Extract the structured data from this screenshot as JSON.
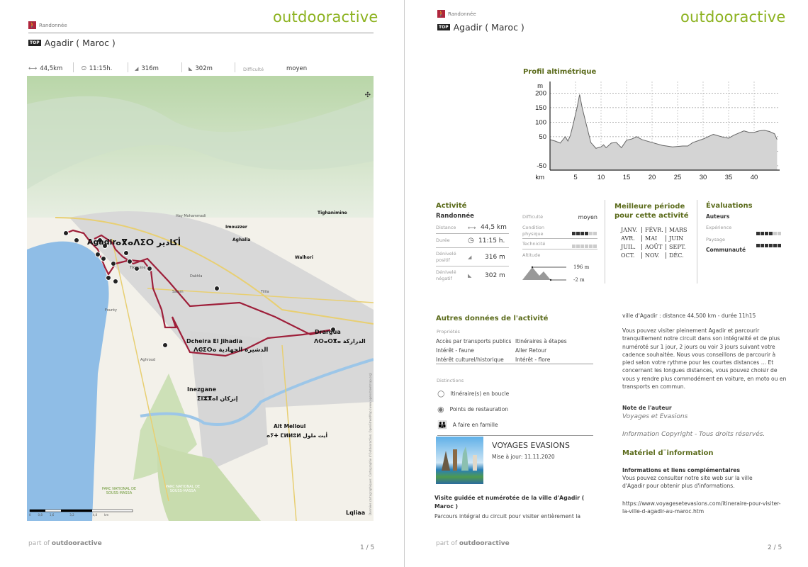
{
  "brand": {
    "logo": "outdooractive",
    "color": "#8cb21f",
    "footer_prefix": "part of",
    "footer_brand": "outdooractive"
  },
  "category": "Randonnée",
  "title": {
    "badge": "TOP",
    "text": "Agadir ( Maroc )"
  },
  "page1": {
    "stats": {
      "distance": "44,5km",
      "duration": "11:15h.",
      "ascent": "316m",
      "descent": "302m",
      "difficulty_label": "Difficulté",
      "difficulty": "moyen"
    },
    "map": {
      "labels": [
        "Agadir",
        "ⴰⴳⴰⴷⵉⵔ أكادير",
        "Dcheira El Jihadia",
        "ⴷⵛⵉⵔⴰ الدشيرة الجهادية",
        "Drargua",
        "ⴷⵔⴰⵔⴳⴰ الدراركة",
        "Inezgane",
        "ⵉⵏⵣⴳⴰⵏ إنزكان",
        "Ait Melloul",
        "ⴰⵢⵜ ⵎⵍⵍⵓⵍ أيت ملول",
        "PARC NATIONAL DE SOUSS-MASSA",
        "PARC NATIONAL DE SOUSS-MASSA",
        "Lqliaa",
        "Salam",
        "Founty",
        "Aghroud",
        "Tikiouine",
        "Tilila",
        "Dakhla",
        "Hay Mohammadi",
        "Imouzzer",
        "Tighanimine",
        "Walhori",
        "Aghalla"
      ],
      "scale": [
        "0",
        "0,8",
        "1,6",
        "3,2",
        "4,8"
      ],
      "scale_unit": "km",
      "route_color": "#9e1f3a",
      "sea_color": "#8fbde6",
      "attribution": "Données cartographiques: Cartographie d'Outdooractive; OpenStreetMap (www.openstreetmap.org)"
    },
    "page_number": "1 / 5"
  },
  "page2": {
    "profile": {
      "title": "Profil altimétrique"
    },
    "chart_data": {
      "type": "area",
      "title": "",
      "xlabel": "km",
      "ylabel": "m",
      "xlim": [
        0,
        45
      ],
      "ylim": [
        -65,
        240
      ],
      "xticks": [
        5,
        10,
        15,
        20,
        25,
        30,
        35,
        40
      ],
      "yticks": [
        200,
        150,
        100,
        50,
        -50
      ],
      "grid": true,
      "x": [
        0,
        1,
        2,
        3,
        3.5,
        4,
        4.5,
        5.3,
        5.8,
        6.3,
        7,
        8,
        9,
        10,
        10.5,
        11,
        12,
        13,
        14,
        15,
        16,
        17,
        18,
        20,
        22,
        24,
        26,
        27,
        28,
        30,
        32,
        34,
        35,
        36,
        38,
        39,
        40,
        41,
        42,
        43,
        44,
        44.5
      ],
      "y": [
        40,
        35,
        28,
        50,
        35,
        55,
        90,
        150,
        195,
        150,
        100,
        30,
        10,
        15,
        22,
        12,
        28,
        30,
        12,
        38,
        42,
        50,
        40,
        30,
        20,
        15,
        18,
        18,
        30,
        42,
        58,
        48,
        45,
        55,
        70,
        65,
        65,
        70,
        72,
        68,
        60,
        40
      ]
    },
    "activity": {
      "heading": "Activité",
      "type": "Randonnée",
      "rows": [
        {
          "label": "Distance",
          "icon": "arrows-horizontal-icon",
          "value": "44,5 km"
        },
        {
          "label": "Durée",
          "icon": "clock-icon",
          "value": "11:15 h."
        },
        {
          "label": "Dénivelé positif",
          "icon": "ascent-icon",
          "value": "316 m"
        },
        {
          "label": "Dénivelé négatif",
          "icon": "descent-icon",
          "value": "302 m"
        }
      ],
      "difficulty_label": "Difficulté",
      "difficulty": "moyen",
      "condition_label": "Condition physique",
      "condition_level": 4,
      "condition_max": 6,
      "technique_label": "Technicité",
      "technique_level": 0,
      "technique_max": 6,
      "altitude_label": "Altitude",
      "alt_max": "196 m",
      "alt_min": "-2 m"
    },
    "season": {
      "heading_1": "Meilleure période",
      "heading_2": "pour cette activité",
      "months": [
        "JANV.",
        "FÉVR.",
        "MARS",
        "AVR.",
        "MAI",
        "JUIN",
        "JUIL.",
        "AOÛT",
        "SEPT.",
        "OCT.",
        "NOV.",
        "DÉC."
      ]
    },
    "ratings": {
      "heading": "Évaluations",
      "authors": "Auteurs",
      "experience_label": "Expérience",
      "experience_level": 4,
      "landscape_label": "Paysage",
      "landscape_level": 6,
      "max": 6,
      "community": "Communauté"
    },
    "other": {
      "heading": "Autres données de l'activité",
      "properties_label": "Propriétés",
      "properties": [
        "Accès par transports publics",
        "Itinéraires à étapes",
        "Intérêt - faune",
        "Aller Retour",
        "Intérêt culturel/historique",
        "Intérêt - flore"
      ],
      "distinctions_label": "Distinctions",
      "distinctions": [
        {
          "icon": "loop-icon",
          "label": "Itinéraire(s) en boucle"
        },
        {
          "icon": "restaurant-icon",
          "label": "Points de restauration"
        },
        {
          "icon": "family-icon",
          "label": "A faire en famille"
        }
      ]
    },
    "author": {
      "name": "VOYAGES EVASIONS",
      "updated": "Mise à jour: 11.11.2020"
    },
    "description": {
      "title": "Visite guidée et numérotée de la ville d'Agadir ( Maroc )",
      "intro": "Parcours intégral du circuit pour visiter entièrement la",
      "cont": "ville d'Agadir : distance 44,500 km - durée 11h15",
      "body": "Vous pouvez visiter pleinement Agadir et parcourir tranquillement notre circuit dans son intégralité et de plus numéroté sur 1 jour, 2 jours ou voir 3 jours suivant votre cadence souhaitée. Nous vous conseillons de parcourir à pied selon votre rythme pour les courtes distances ... Et concernant les longues distances, vous pouvez choisir de vous y rendre plus commodément en voiture, en moto ou en transports en commun."
    },
    "author_note": {
      "label": "Note de l'auteur",
      "value": "Voyages et Evasions"
    },
    "copyright": "Information Copyright - Tous droits réservés.",
    "info": {
      "heading": "Matériel d¨information",
      "sub": "Informations et liens complémentaires",
      "text": "Vous pouvez consulter notre site web sur la ville d'Agadir pour obtenir plus d'informations.",
      "url": "https://www.voyagesetevasions.com/itineraire-pour-visiter-la-ville-d-agadir-au-maroc.htm"
    },
    "page_number": "2 / 5"
  }
}
